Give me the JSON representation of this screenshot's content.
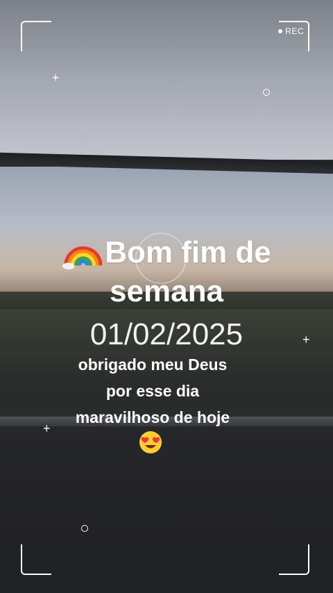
{
  "recorder": {
    "rec_label": "REC"
  },
  "overlay": {
    "title_icon": "rainbow-icon",
    "title": "Bom fim de semana",
    "date": "01/02/2025",
    "message_lines": [
      "obrigado meu Deus",
      "por esse dia",
      "maravilhoso de hoje"
    ],
    "emoji_icon": "heart-eyes-emoji-icon"
  },
  "colors": {
    "text": "#ffffff",
    "frame": "#ffffff"
  }
}
